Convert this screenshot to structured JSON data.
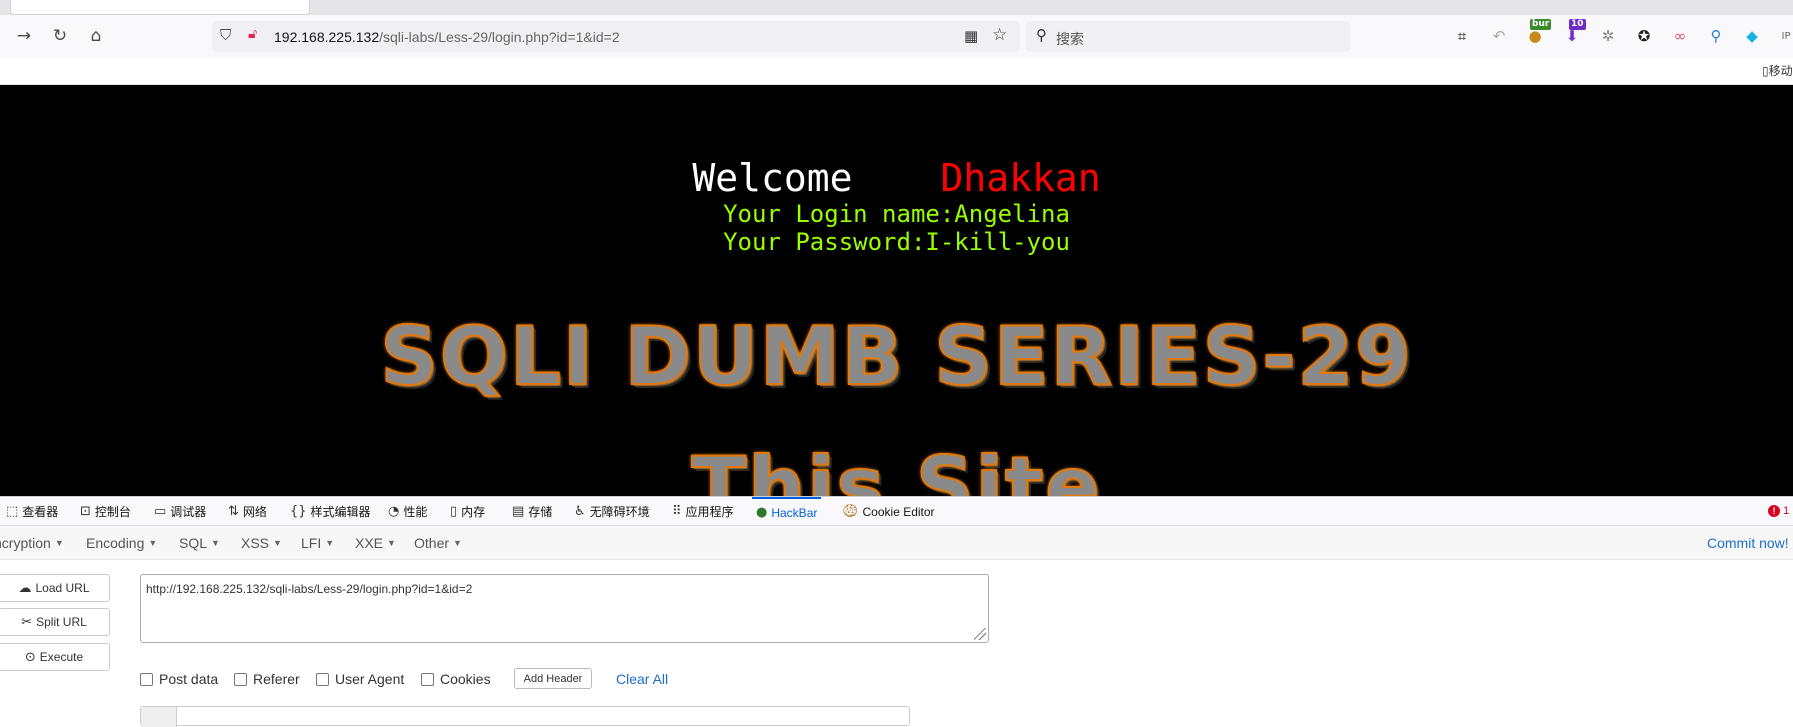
{
  "browser": {
    "url_host": "192.168.225.132",
    "url_path": "/sqli-labs/Less-29/login.php?id=1&id=2",
    "search_placeholder": "搜索",
    "extension_badges": {
      "burp": "bur",
      "count": "10"
    },
    "mobile_label": "移动"
  },
  "page": {
    "welcome_label": "Welcome",
    "welcome_name": "Dhakkan",
    "login_name_line": "Your Login name:Angelina",
    "password_line": "Your Password:I-kill-you",
    "banner_title": "SQLI DUMB SERIES-29",
    "banner_sub": "This Site",
    "colors": {
      "background": "#000000",
      "welcome": "#ffffff",
      "name": "#ff0000",
      "info": "#99ff00"
    }
  },
  "devtools": {
    "tabs": [
      {
        "label": "查看器",
        "icon": "inspector-icon"
      },
      {
        "label": "控制台",
        "icon": "console-icon"
      },
      {
        "label": "调试器",
        "icon": "debugger-icon"
      },
      {
        "label": "网络",
        "icon": "network-icon"
      },
      {
        "label": "样式编辑器",
        "icon": "style-editor-icon"
      },
      {
        "label": "性能",
        "icon": "performance-icon"
      },
      {
        "label": "内存",
        "icon": "memory-icon"
      },
      {
        "label": "存储",
        "icon": "storage-icon"
      },
      {
        "label": "无障碍环境",
        "icon": "accessibility-icon"
      },
      {
        "label": "应用程序",
        "icon": "application-icon"
      },
      {
        "label": "HackBar",
        "icon": "hackbar-icon"
      },
      {
        "label": "Cookie Editor",
        "icon": "cookie-icon"
      }
    ],
    "active_tab": "HackBar",
    "error_count": "1"
  },
  "hackbar": {
    "menu": [
      "ncryption",
      "Encoding",
      "SQL",
      "XSS",
      "LFI",
      "XXE",
      "Other"
    ],
    "commit_label": "Commit now!",
    "load_url": "Load URL",
    "split_url": "Split URL",
    "execute": "Execute",
    "url_value": "http://192.168.225.132/sqli-labs/Less-29/login.php?id=1&id=2",
    "checkboxes": [
      "Post data",
      "Referer",
      "User Agent",
      "Cookies"
    ],
    "add_header": "Add Header",
    "clear_all": "Clear All"
  }
}
